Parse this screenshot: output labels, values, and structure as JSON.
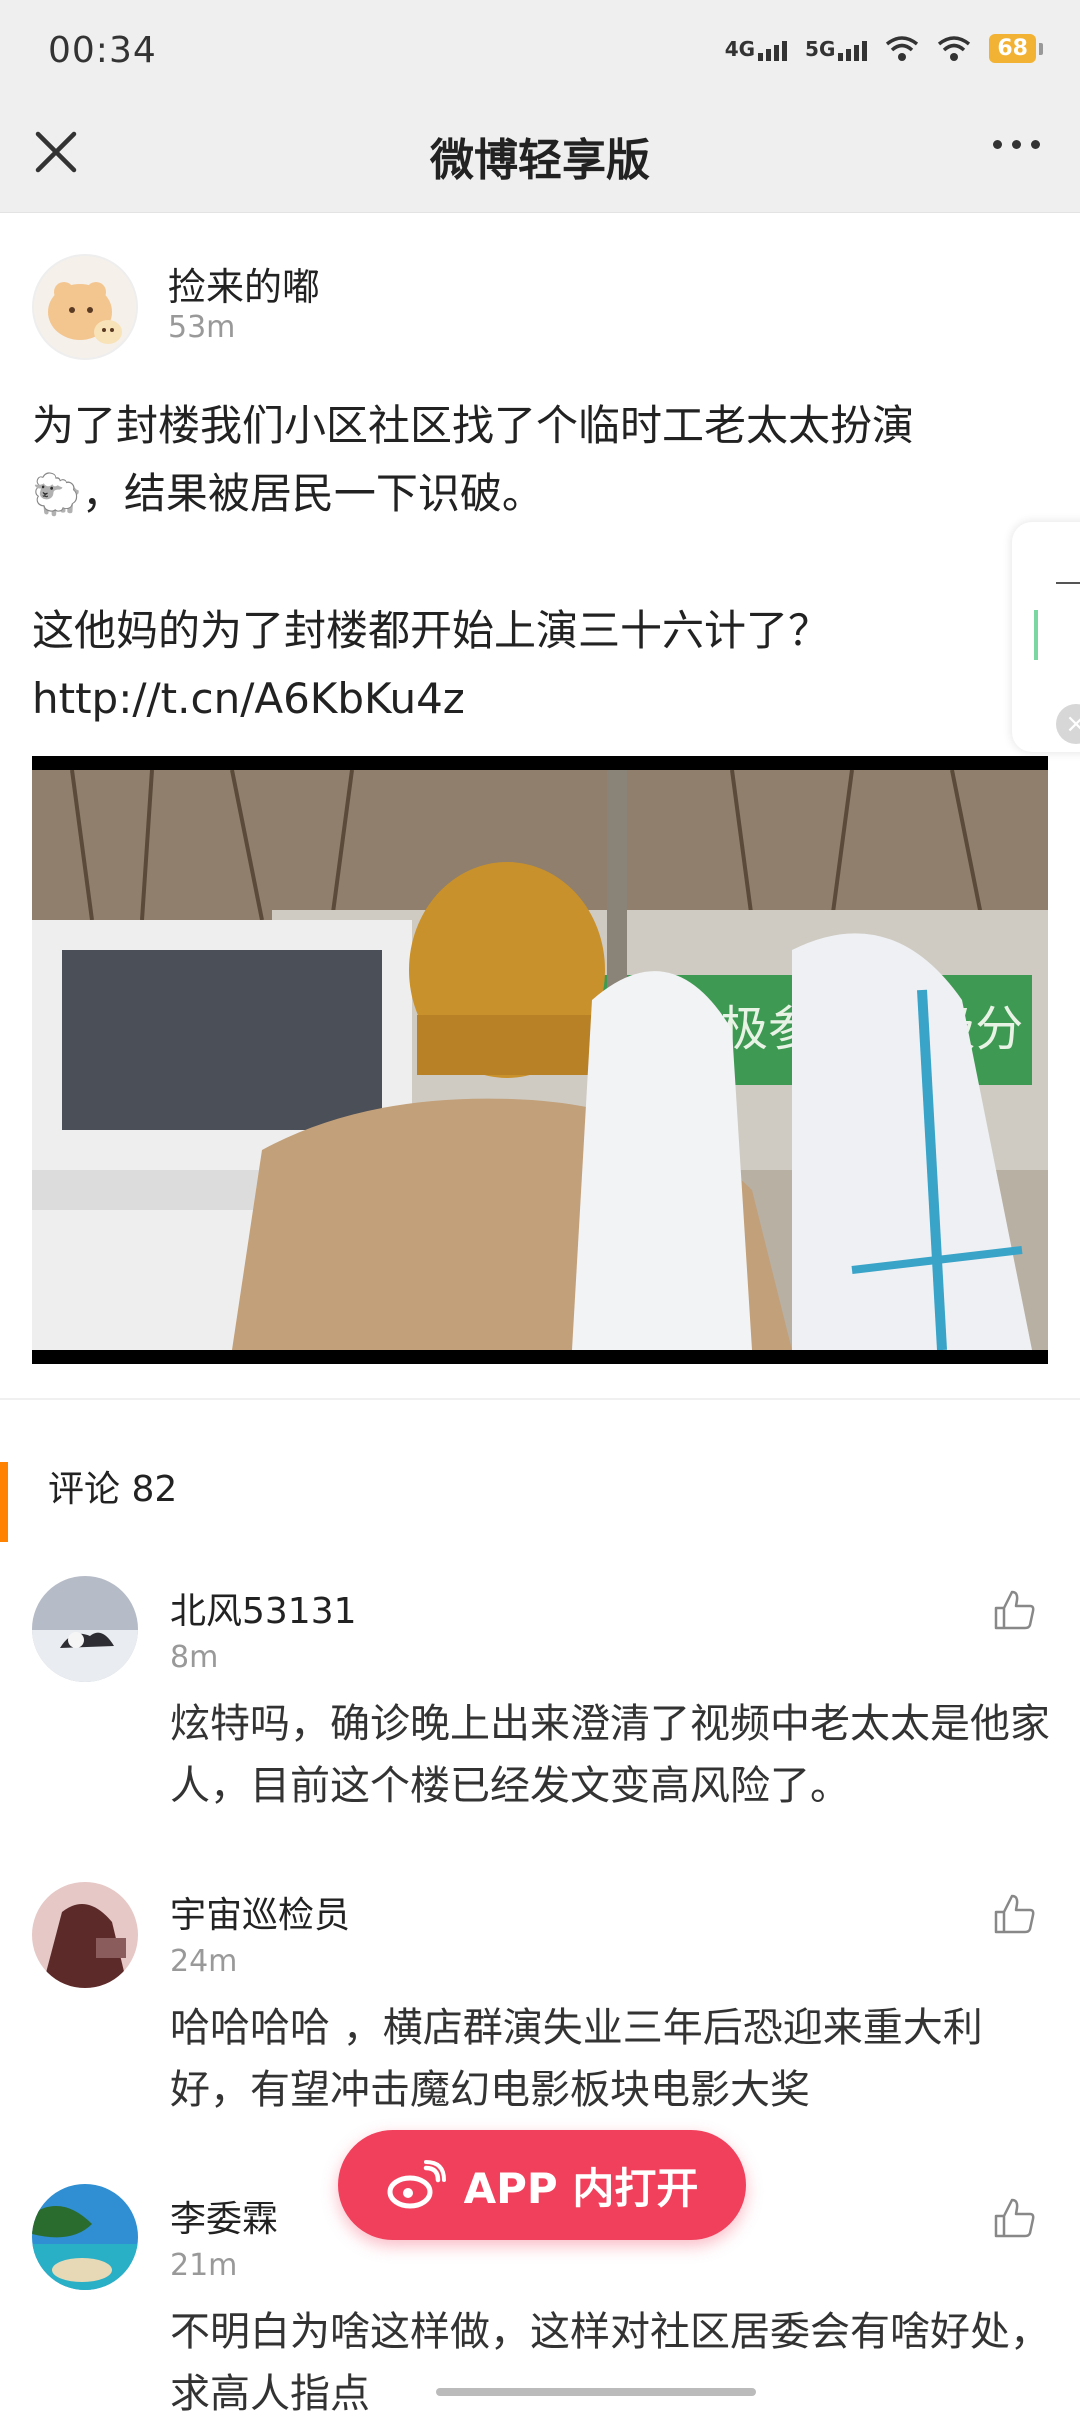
{
  "status_bar": {
    "time": "00:34",
    "network_1": "4G",
    "network_2": "5G",
    "battery": "68"
  },
  "title_bar": {
    "title": "微博轻享版",
    "close_icon": "close-icon",
    "more_icon": "more-icon"
  },
  "post": {
    "username": "捡来的嘟",
    "time": "53m",
    "text_line1": "为了封楼我们小区社区找了个临时工老太太扮演",
    "text_line2": "，结果被居民一下识破。",
    "text_line3": "这他妈的为了封楼都开始上演三十六计了？",
    "link": "http://t.cn/A6KbKu4z",
    "sheep_emoji": "🐑",
    "video_banner_text": "积极参与 积极分"
  },
  "comments_header": {
    "label": "评论 82"
  },
  "comments": [
    {
      "name": "北风53131",
      "time": "8m",
      "text": "炫特吗，确诊晚上出来澄清了视频中老太太是他家人，目前这个楼已经发文变高风险了。"
    },
    {
      "name": "宇宙巡检员",
      "time": "24m",
      "text": "哈哈哈哈 ，横店群演失业三年后恐迎来重大利好，有望冲击魔幻电影板块电影大奖"
    },
    {
      "name": "李委霖",
      "time": "21m",
      "text": "不明白为啥这样做，这样对社区居委会有啥好处，求高人指点"
    }
  ],
  "app_button": {
    "label": "APP 内打开"
  },
  "colors": {
    "accent_orange": "#ff8200",
    "app_button": "#f1405c",
    "bar_bg": "#efefef"
  }
}
